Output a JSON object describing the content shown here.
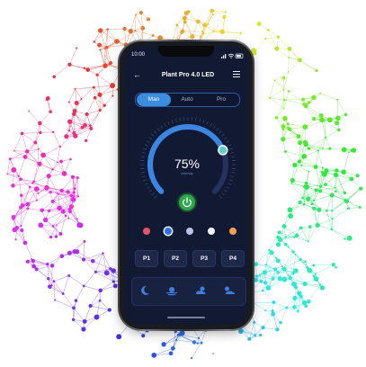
{
  "status_bar": {
    "time": "10:00"
  },
  "header": {
    "title": "Plant Pro 4.0 LED"
  },
  "tabs": [
    {
      "label": "Man",
      "active": true
    },
    {
      "label": "Auto",
      "active": false
    },
    {
      "label": "Pro",
      "active": false
    }
  ],
  "intensity": {
    "value_text": "75%",
    "value": 75,
    "label": "Intensity"
  },
  "color_channels": [
    {
      "color": "#e8536a",
      "selected": false
    },
    {
      "color": "#2f6fe0",
      "selected": true
    },
    {
      "color": "#b9c3ec",
      "selected": false
    },
    {
      "color": "#f4f6fb",
      "selected": false
    },
    {
      "color": "#f2a24a",
      "selected": false
    }
  ],
  "presets": [
    "P1",
    "P2",
    "P3",
    "P4"
  ],
  "modes": [
    "moon-icon",
    "sunrise-icon",
    "sunny-cloud-icon",
    "cloud-sun-icon"
  ],
  "colors": {
    "accent": "#3b8de0",
    "power": "#2aa84a",
    "screen_bg": "#121a33"
  }
}
